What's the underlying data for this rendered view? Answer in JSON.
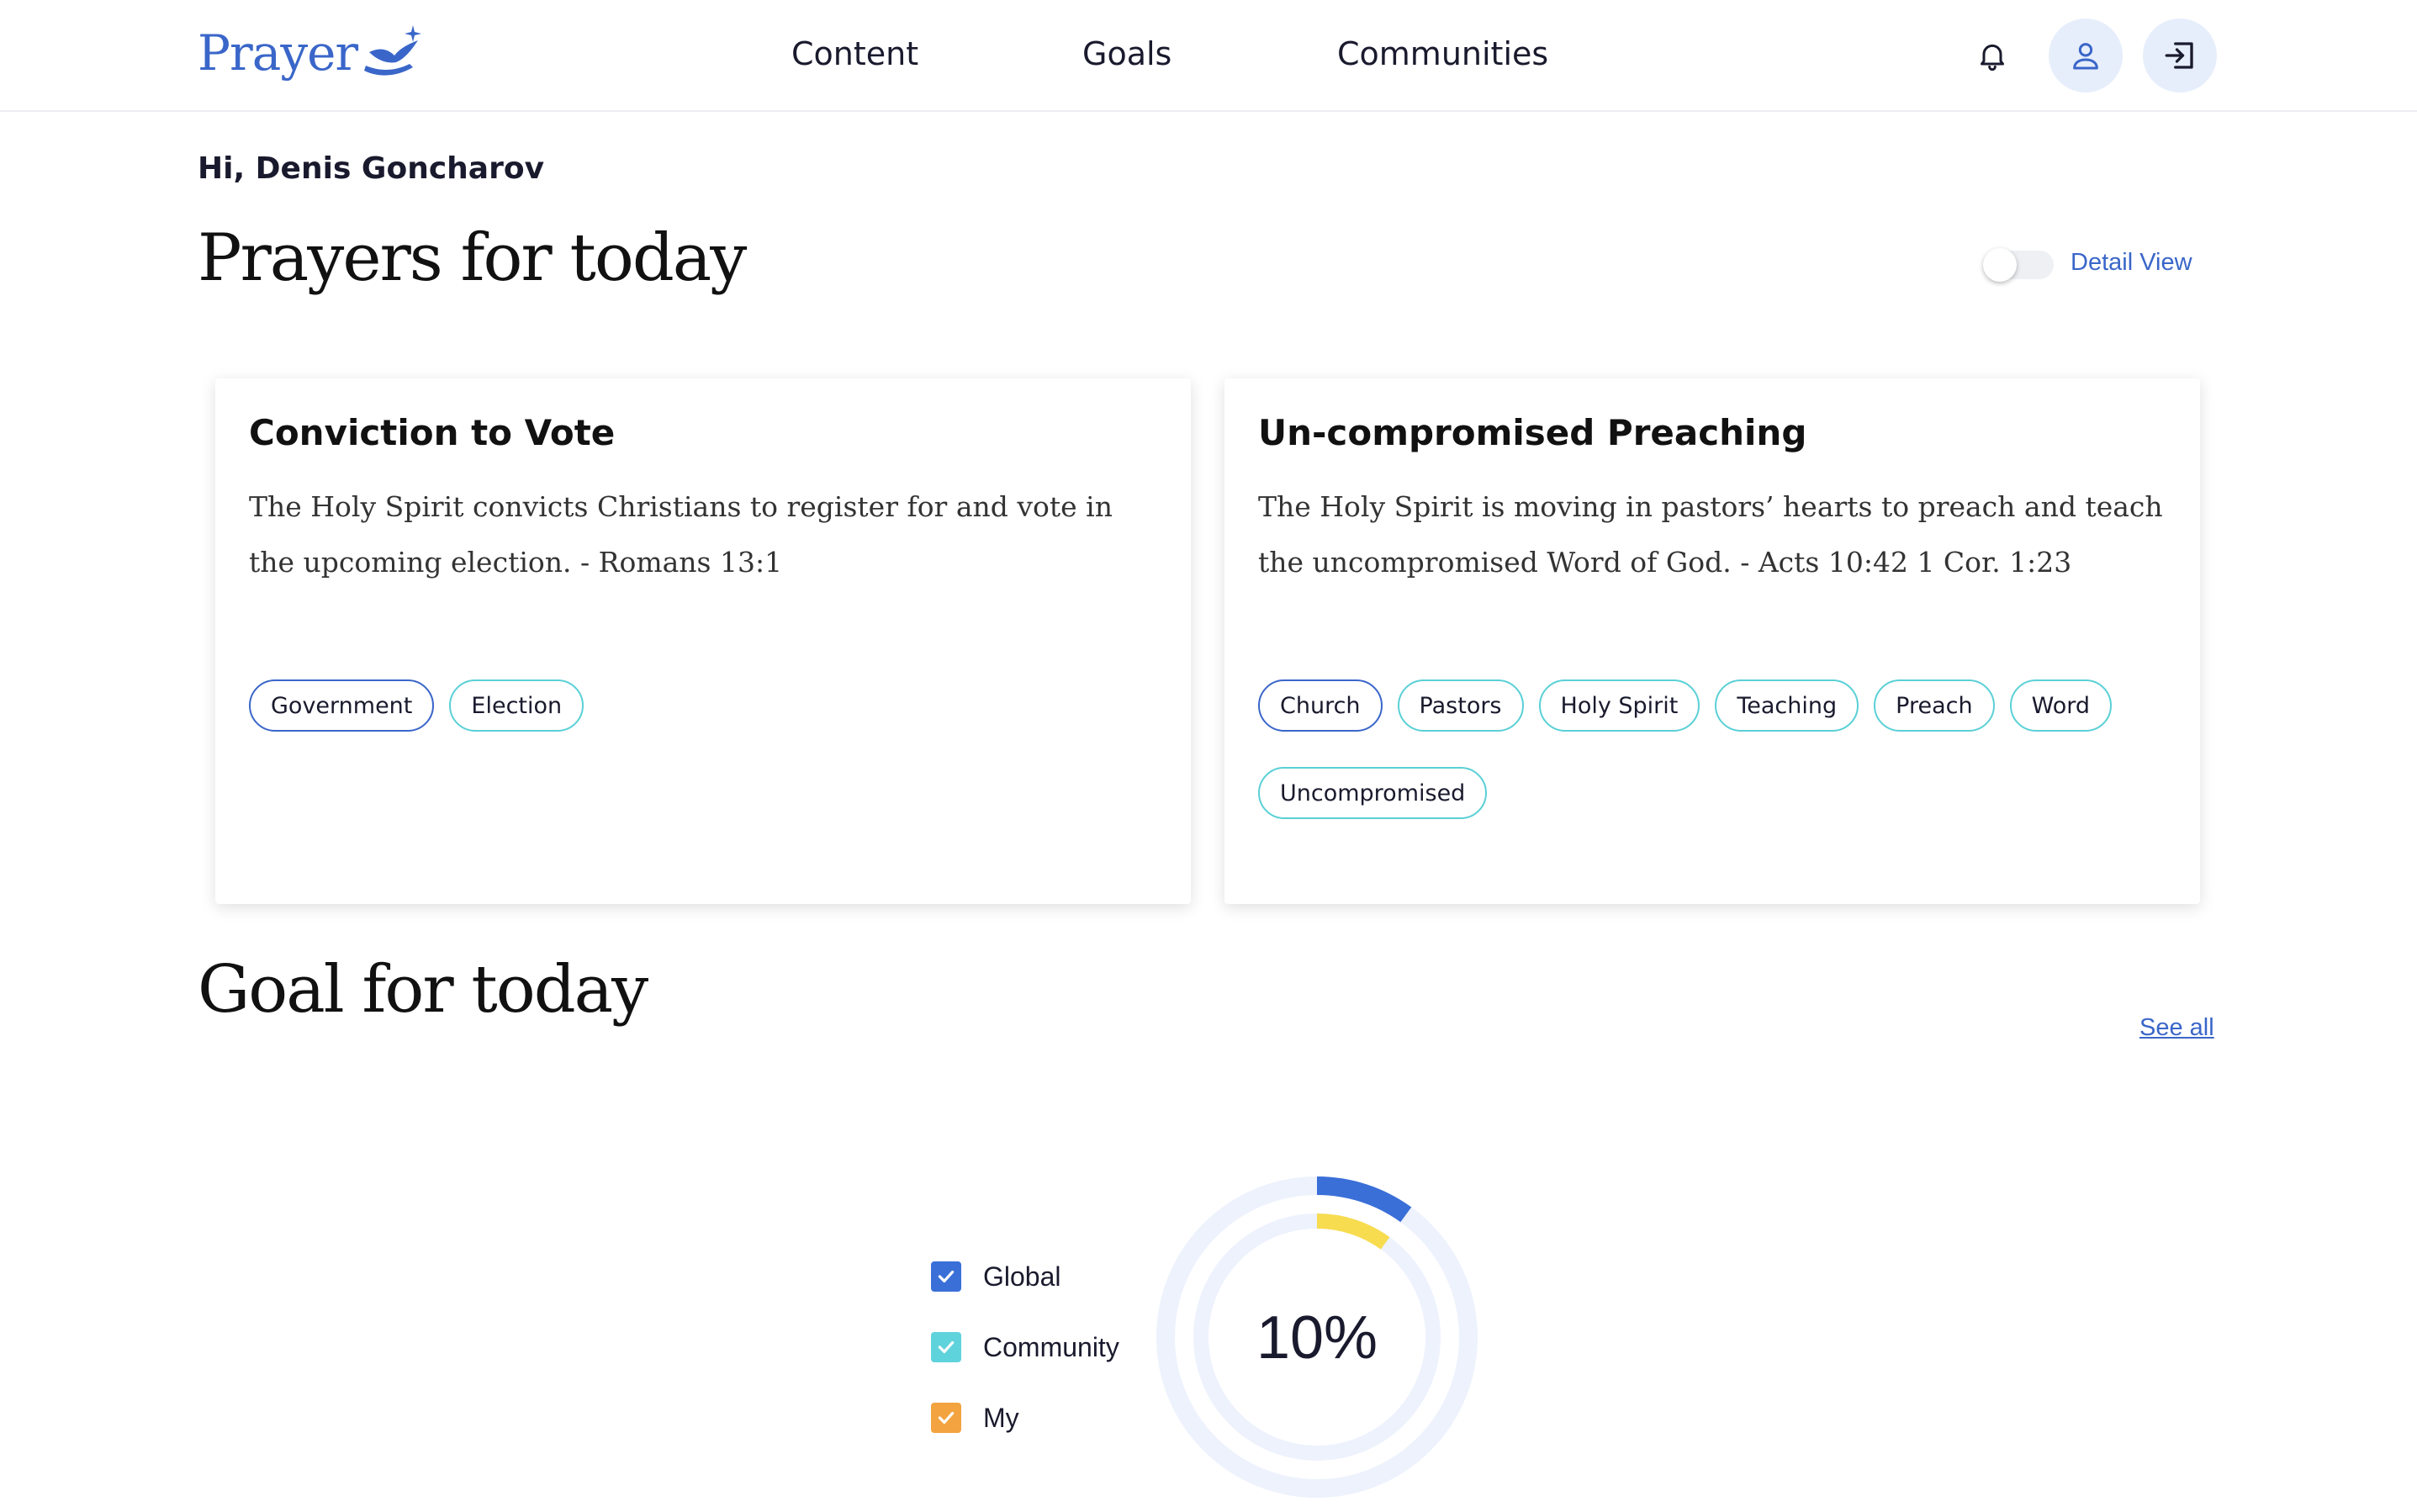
{
  "header": {
    "logo_text": "Prayer",
    "nav": [
      "Content",
      "Goals",
      "Communities"
    ],
    "icons": [
      "bell-icon",
      "user-icon",
      "logout-icon"
    ]
  },
  "greeting": "Hi, Denis Goncharov",
  "prayers": {
    "title": "Prayers for today",
    "detail_view_label": "Detail View",
    "detail_view_on": false,
    "cards": [
      {
        "title": "Conviction to Vote",
        "body": "The Holy Spirit convicts Christians to register for and vote in the upcoming election. - Romans 13:1",
        "tags": [
          "Government",
          "Election"
        ]
      },
      {
        "title": "Un-compromised Preaching",
        "body": "The Holy Spirit is moving in pastors’ hearts to preach and teach the uncompromised Word of God. - Acts 10:42 1 Cor. 1:23",
        "tags": [
          "Church",
          "Pastors",
          "Holy Spirit",
          "Teaching",
          "Preach",
          "Word",
          "Uncompromised"
        ]
      }
    ]
  },
  "goals": {
    "title": "Goal for today",
    "see_all_label": "See all",
    "legend": [
      {
        "label": "Global",
        "color": "#3a6fd8",
        "checked": true
      },
      {
        "label": "Community",
        "color": "#5fd3dc",
        "checked": true
      },
      {
        "label": "My",
        "color": "#f3a33f",
        "checked": true
      }
    ],
    "percent_label": "10%"
  },
  "chart_data": {
    "type": "pie",
    "title": "",
    "center_label": "10%",
    "series": [
      {
        "name": "Global",
        "value": 0.1,
        "color": "#3a6fd8"
      },
      {
        "name": "Community",
        "value": 0.1,
        "color": "#f7dc4f"
      }
    ],
    "track_color": "#edf2fd"
  }
}
